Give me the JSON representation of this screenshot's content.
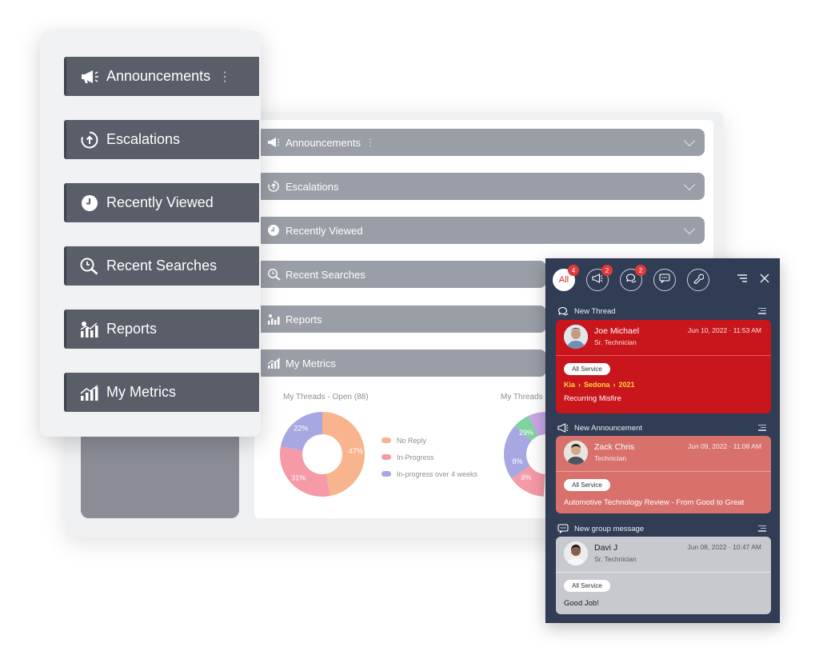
{
  "dashboard": {
    "accordion": [
      {
        "label": "Announcements",
        "icon": "megaphone-icon",
        "has_menu": true
      },
      {
        "label": "Escalations",
        "icon": "escalation-icon"
      },
      {
        "label": "Recently Viewed",
        "icon": "clock-icon"
      },
      {
        "label": "Recent Searches",
        "icon": "history-search-icon"
      },
      {
        "label": "Reports",
        "icon": "reports-icon"
      },
      {
        "label": "My Metrics",
        "icon": "metrics-icon"
      }
    ],
    "charts": [
      {
        "title": "My Threads - Open (88)"
      },
      {
        "title": "My Threads - ..."
      }
    ],
    "legend": [
      "No Reply",
      "In-Progress",
      "In-progress over 4 weeks"
    ]
  },
  "chart_data": [
    {
      "type": "pie",
      "title": "My Threads - Open (88)",
      "categories": [
        "No Reply",
        "In-Progress",
        "In-progress over 4 weeks"
      ],
      "values": [
        47,
        31,
        22
      ],
      "value_labels": [
        "47%",
        "31%",
        "22%"
      ],
      "colors": [
        "#f8b48c",
        "#f59aa6",
        "#a7a7e2"
      ]
    },
    {
      "type": "pie",
      "title": "My Threads - ...",
      "visible_labels": [
        "29%",
        "8%",
        "8%"
      ]
    }
  ],
  "sidebar": {
    "items": [
      {
        "label": "Announcements",
        "icon": "megaphone-icon",
        "has_menu": true
      },
      {
        "label": "Escalations",
        "icon": "escalation-icon"
      },
      {
        "label": "Recently Viewed",
        "icon": "clock-icon"
      },
      {
        "label": "Recent Searches",
        "icon": "history-search-icon"
      },
      {
        "label": "Reports",
        "icon": "reports-icon"
      },
      {
        "label": "My Metrics",
        "icon": "metrics-icon"
      }
    ]
  },
  "notifications": {
    "tabs": [
      {
        "label": "All",
        "badge": "4",
        "active": true
      },
      {
        "icon": "megaphone-icon",
        "badge": "2"
      },
      {
        "icon": "chat-bubbles-icon",
        "badge": "2"
      },
      {
        "icon": "group-message-icon"
      },
      {
        "icon": "wrench-icon"
      }
    ],
    "sections": [
      {
        "heading": "New Thread",
        "icon": "chat-bubbles-icon",
        "card": {
          "name": "Joe Michael",
          "role": "Sr. Technician",
          "date": "Jun 10, 2022 · 11:53 AM",
          "tag": "All Service",
          "breadcrumb": [
            "Kia",
            "Sedona",
            "2021"
          ],
          "message": "Recurring Misfire"
        }
      },
      {
        "heading": "New Announcement",
        "icon": "megaphone-icon",
        "card": {
          "name": "Zack Chris",
          "role": "Technician",
          "date": "Jun 09, 2022 · 11:08 AM",
          "tag": "All Service",
          "message": "Automotive Technology Review - From Good to Great"
        }
      },
      {
        "heading": "New group message",
        "icon": "group-message-icon",
        "card": {
          "name": "Davi J",
          "role": "Sr. Technician",
          "date": "Jun 08, 2022 · 10:47 AM",
          "tag": "All Service",
          "message": "Good Job!"
        }
      }
    ]
  },
  "colors": {
    "sidebar_button": "#595e68",
    "accordion_bar": "#9a9ea6",
    "panel_bg": "#313c55",
    "card_red": "#c8161c",
    "card_pink": "#d8716c",
    "card_grey": "#c7c9cf",
    "crumb_yellow": "#ffd43b",
    "badge_red": "#e03b3b"
  }
}
